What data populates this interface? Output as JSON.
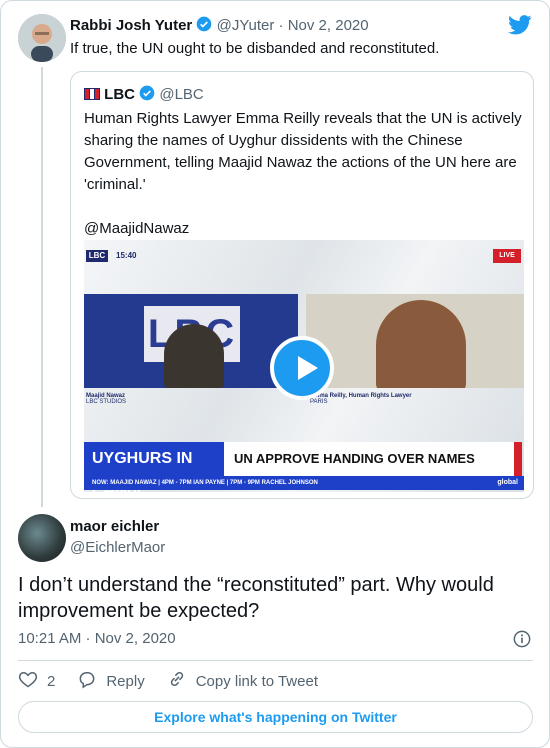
{
  "parent_tweet": {
    "author_name": "Rabbi Josh Yuter",
    "author_handle": "@JYuter",
    "separator": "·",
    "date": "Nov 2, 2020",
    "text": "If true, the UN ought to be disbanded and reconstituted."
  },
  "quoted_tweet": {
    "author_name": "LBC",
    "author_handle": "@LBC",
    "text": "Human Rights Lawyer Emma Reilly reveals that the UN is actively sharing the names of Uyghur dissidents with the Chinese Government, telling Maajid Nawaz the actions of the UN here are 'criminal.'",
    "mention": "@MaajidNawaz",
    "video": {
      "logo": "LBC",
      "clock": "15:40",
      "live_badge": "LIVE",
      "studio_logo": "LBC",
      "studio_caption_name": "Maajid Nawaz",
      "studio_caption_location": "LBC STUDIOS",
      "guest_caption_name": "Emma Reilly, Human Rights Lawyer",
      "guest_caption_location": "PARIS",
      "ticker_topic": "UYGHURS IN CHINA",
      "ticker_headline": "UN APPROVE HANDING OVER NAMES",
      "ticker_schedule": "NOW: MAAJID NAWAZ  |  4PM - 7PM IAN PAYNE  |  7PM - 9PM RACHEL JOHNSON",
      "ticker_brand": "global"
    }
  },
  "reply_tweet": {
    "author_name": "maor eichler",
    "author_handle": "@EichlerMaor",
    "text": "I don’t understand the “reconstituted” part. Why would improvement be expected?",
    "timestamp": "10:21 AM · Nov 2, 2020",
    "like_count": "2",
    "reply_label": "Reply",
    "copy_link_label": "Copy link to Tweet"
  },
  "footer": {
    "explore_label": "Explore what's happening on Twitter"
  },
  "colors": {
    "brand_blue": "#1d9bf0",
    "text": "#0f1419",
    "muted": "#536471",
    "border": "#cfd9de"
  },
  "icons": [
    "twitter-bird-icon",
    "verified-badge-icon",
    "info-icon",
    "heart-icon",
    "reply-icon",
    "link-icon",
    "play-icon"
  ]
}
